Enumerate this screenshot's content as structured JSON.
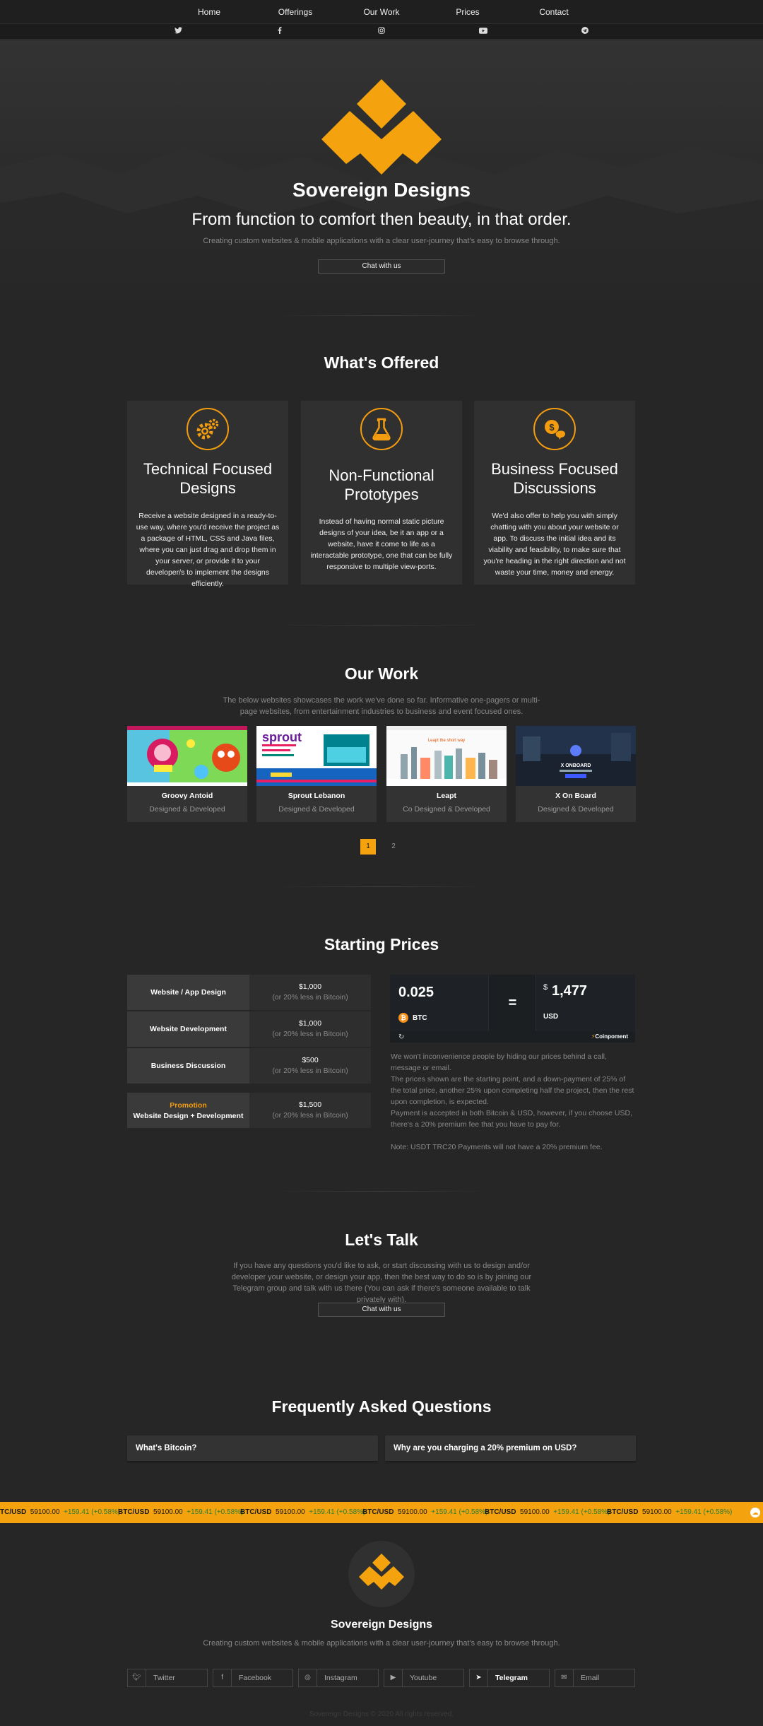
{
  "nav": {
    "links": [
      "Home",
      "Offerings",
      "Our Work",
      "Prices",
      "Contact"
    ],
    "social_icons": [
      "twitter-icon",
      "facebook-icon",
      "instagram-icon",
      "youtube-icon",
      "telegram-icon"
    ]
  },
  "hero": {
    "title": "Sovereign Designs",
    "subtitle": "From function to comfort then beauty, in that order.",
    "description": "Creating custom websites & mobile applications with a clear user-journey that's easy to browse through.",
    "cta": "Chat with us"
  },
  "offered": {
    "title": "What's Offered",
    "cards": [
      {
        "icon": "gears-icon",
        "title": "Technical Focused Designs",
        "text": "Receive a website designed in a ready-to-use way, where you'd receive the project as a package of HTML, CSS and Java files, where you can just drag and drop them in your server, or provide it to your developer/s to implement the designs efficiently."
      },
      {
        "icon": "flask-icon",
        "title": "Non-Functional Prototypes",
        "text": "Instead of having normal static picture designs of your idea, be it an app or a website, have it come to life as a interactable prototype, one that can be fully responsive to multiple view-ports."
      },
      {
        "icon": "chat-dollar-icon",
        "title": "Business Focused Discussions",
        "text": "We'd also offer to help you with simply chatting with you about your website or app. To discuss the initial idea and its viability and feasibility, to make sure that you're heading in the right direction and not waste your time, money and energy."
      }
    ]
  },
  "work": {
    "title": "Our Work",
    "description": "The below websites showcases the work we've done so far. Informative one-pagers or multi-page websites, from entertainment industries to business and event focused ones.",
    "items": [
      {
        "name": "Groovy Antoid",
        "role": "Designed & Developed"
      },
      {
        "name": "Sprout Lebanon",
        "role": "Designed & Developed"
      },
      {
        "name": "Leapt",
        "role": "Co Designed & Developed"
      },
      {
        "name": "X On Board",
        "role": "Designed & Developed"
      }
    ],
    "thumb_texts": {
      "sprout": "sprout",
      "leapt": "Leapt the short way",
      "xonboard": "X ONBOARD"
    },
    "pages": [
      "1",
      "2"
    ],
    "active_page": "1"
  },
  "prices": {
    "title": "Starting Prices",
    "rows": [
      {
        "label": "Website / App Design",
        "price": "$1,000",
        "note": "(or 20% less in Bitcoin)"
      },
      {
        "label": "Website Development",
        "price": "$1,000",
        "note": "(or 20% less in Bitcoin)"
      },
      {
        "label": "Business Discussion",
        "price": "$500",
        "note": "(or 20% less in Bitcoin)"
      }
    ],
    "promo": {
      "tag": "Promotion",
      "label": "Website Design + Development",
      "price": "$1,500",
      "note": "(or 20% less in Bitcoin)"
    },
    "converter": {
      "btc_amount": "0.025",
      "btc_label": "BTC",
      "equals": "=",
      "usd_symbol": "$",
      "usd_amount": "1,477",
      "usd_label": "USD",
      "brand": "Coinpoment"
    },
    "notes": [
      "We won't inconvenience people by hiding our prices behind a call, message or email.",
      "The prices shown are the starting point, and a down-payment of 25% of the total price, another 25% upon completing half the project, then the rest upon completion, is expected.",
      "Payment is accepted in both Bitcoin & USD, however, if you choose USD, there's a 20% premium fee that you have to pay for.",
      "Note: USDT TRC20 Payments will not have a 20% premium fee."
    ]
  },
  "talk": {
    "title": "Let's Talk",
    "description": "If you have any questions you'd like to ask, or start discussing with us to design and/or developer your website, or design your app, then the best way to do so is by joining our Telegram group and talk with us there (You can ask if there's someone available to talk privately with).",
    "cta": "Chat with us"
  },
  "faq": {
    "title": "Frequently Asked Questions",
    "items": [
      "What's Bitcoin?",
      "Why are you charging a 20% premium on USD?"
    ]
  },
  "ticker": {
    "pair": "BTC/USD",
    "price": "59100.00",
    "change": "+159.41 (+0.58%)",
    "first_pair": "TC/USD"
  },
  "footer": {
    "title": "Sovereign Designs",
    "description": "Creating custom websites & mobile applications with a clear user-journey that's easy to browse through.",
    "links": [
      {
        "icon": "twitter-icon",
        "label": "Twitter"
      },
      {
        "icon": "facebook-icon",
        "label": "Facebook"
      },
      {
        "icon": "instagram-icon",
        "label": "Instagram"
      },
      {
        "icon": "youtube-icon",
        "label": "Youtube"
      },
      {
        "icon": "telegram-icon",
        "label": "Telegram"
      },
      {
        "icon": "email-icon",
        "label": "Email"
      }
    ],
    "copyright": "Sovereign Designs © 2020 All rights reserved."
  },
  "colors": {
    "accent": "#f39c0f",
    "background": "#262626",
    "card": "#303030",
    "ticker": "#f4a30f"
  }
}
